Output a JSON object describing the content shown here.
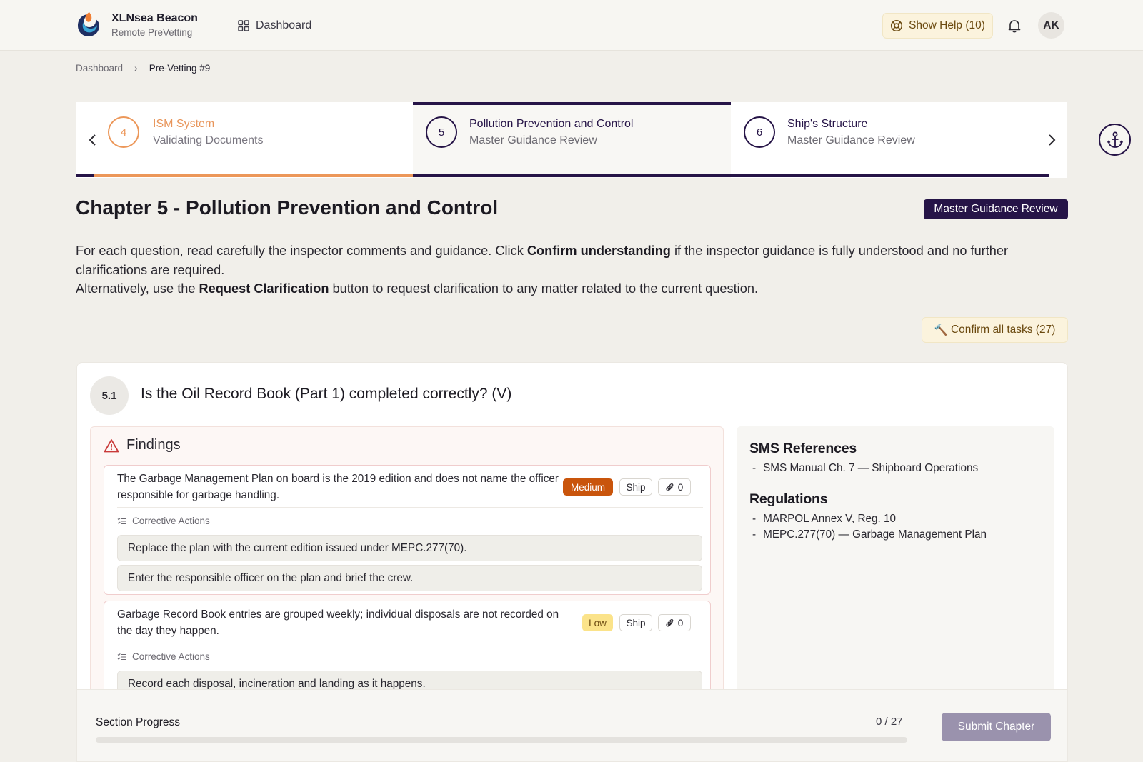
{
  "app": {
    "name": "XLNsea Beacon",
    "subtitle": "Remote PreVetting"
  },
  "nav": {
    "dashboard_label": "Dashboard"
  },
  "header": {
    "help_label": "Show Help (10)",
    "avatar_initials": "AK"
  },
  "breadcrumb": {
    "root": "Dashboard",
    "current": "Pre-Vetting #9"
  },
  "stepper": {
    "steps": [
      {
        "number": "4",
        "title": "ISM System",
        "status": "Validating Documents"
      },
      {
        "number": "5",
        "title": "Pollution Prevention and Control",
        "status": "Master Guidance Review"
      },
      {
        "number": "6",
        "title": "Ship's Structure",
        "status": "Master Guidance Review"
      }
    ],
    "active_color": "#261447",
    "pending_color": "#ec9759"
  },
  "chapter": {
    "title": "Chapter 5 - Pollution Prevention and Control",
    "mode_badge": "Master Guidance Review",
    "intro_part1": "For each question, read carefully the inspector comments and guidance. Click ",
    "intro_bold1": "Confirm understanding",
    "intro_part2": " if the inspector guidance is fully understood and no further clarifications are required.",
    "intro_part3": "Alternatively, use the ",
    "intro_bold2": "Request Clarification",
    "intro_part4": " button to request clarification to any matter related to the current question.",
    "confirm_all_label": "Confirm all tasks (27)"
  },
  "question": {
    "number": "5.1",
    "text": "Is the Oil Record Book (Part 1) completed correctly? (V)",
    "findings_title": "Findings",
    "findings": [
      {
        "text": "The Garbage Management Plan on board is the 2019 edition and does not name the officer responsible for garbage handling.",
        "severity": "Medium",
        "scope": "Ship",
        "attachments": "0",
        "corrective_label": "Corrective Actions",
        "actions": [
          "Replace the plan with the current edition issued under MEPC.277(70).",
          "Enter the responsible officer on the plan and brief the crew."
        ]
      },
      {
        "text": "Garbage Record Book entries are grouped weekly; individual disposals are not recorded on the day they happen.",
        "severity": "Low",
        "scope": "Ship",
        "attachments": "0",
        "corrective_label": "Corrective Actions",
        "actions": [
          "Record each disposal, incineration and landing as it happens."
        ]
      }
    ],
    "sms_title": "SMS References",
    "sms_refs": [
      "SMS Manual Ch. 7 — Shipboard Operations"
    ],
    "reg_title": "Regulations",
    "regulations": [
      "MARPOL Annex V, Reg. 10",
      "MEPC.277(70) — Garbage Management Plan"
    ]
  },
  "progress": {
    "label": "Section Progress",
    "count": "0 / 27",
    "fraction": 0,
    "submit_label": "Submit Chapter"
  }
}
